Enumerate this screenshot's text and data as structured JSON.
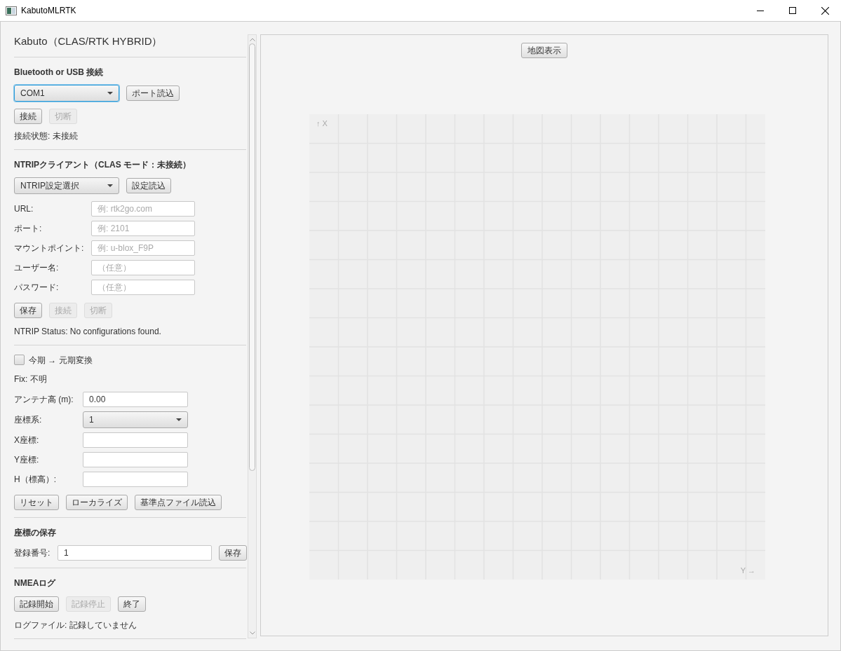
{
  "window": {
    "title": "KabutoMLRTK"
  },
  "app_title": "Kabuto（CLAS/RTK HYBRID）",
  "connection": {
    "heading": "Bluetooth or USB 接続",
    "port": {
      "value": "COM1",
      "focused": true
    },
    "load_button": "ポート読込",
    "buttons": [
      {
        "label": "接続",
        "disabled": false
      },
      {
        "label": "切断",
        "disabled": true
      }
    ],
    "status": "接続状態: 未接続"
  },
  "ntrip": {
    "heading": "NTRIPクライアント（CLAS モード：未接続）",
    "preset": {
      "value": "NTRIP設定選択",
      "focused": false
    },
    "load_button": "設定読込",
    "fields": [
      {
        "label": "URL:",
        "placeholder": "例: rtk2go.com"
      },
      {
        "label": "ポート:",
        "placeholder": "例: 2101"
      },
      {
        "label": "マウントポイント:",
        "placeholder": "例: u-blox_F9P"
      },
      {
        "label": "ユーザー名:",
        "placeholder": "（任意）"
      },
      {
        "label": "パスワード:",
        "placeholder": "（任意）"
      }
    ],
    "buttons": [
      {
        "label": "保存",
        "disabled": false
      },
      {
        "label": "接続",
        "disabled": true
      },
      {
        "label": "切断",
        "disabled": true
      }
    ],
    "status": "NTRIP Status: No configurations found."
  },
  "position": {
    "convert": {
      "label": "今期 → 元期変換",
      "checked": false
    },
    "fix": "Fix: 不明",
    "fields": [
      {
        "kind": "input",
        "label": "アンテナ高 (m):",
        "value": "0.00"
      },
      {
        "kind": "select",
        "label": "座標系:",
        "value": "1"
      },
      {
        "kind": "input",
        "label": "X座標:"
      },
      {
        "kind": "input",
        "label": "Y座標:"
      },
      {
        "kind": "input",
        "label": "H（標高）:"
      }
    ],
    "buttons": [
      {
        "label": "リセット",
        "disabled": false
      },
      {
        "label": "ローカライズ",
        "disabled": false
      },
      {
        "label": "基準点ファイル読込",
        "disabled": false
      }
    ]
  },
  "save": {
    "heading": "座標の保存",
    "label": "登録番号:",
    "value": "1",
    "button": "保存"
  },
  "nmea": {
    "heading": "NMEAログ",
    "buttons": [
      {
        "label": "記録開始",
        "disabled": false
      },
      {
        "label": "記録停止",
        "disabled": true
      },
      {
        "label": "終了",
        "disabled": false
      }
    ],
    "status": "ログファイル: 記録していません"
  },
  "map": {
    "button": "地図表示",
    "x_label": "↑ X",
    "y_label": "Y →"
  }
}
